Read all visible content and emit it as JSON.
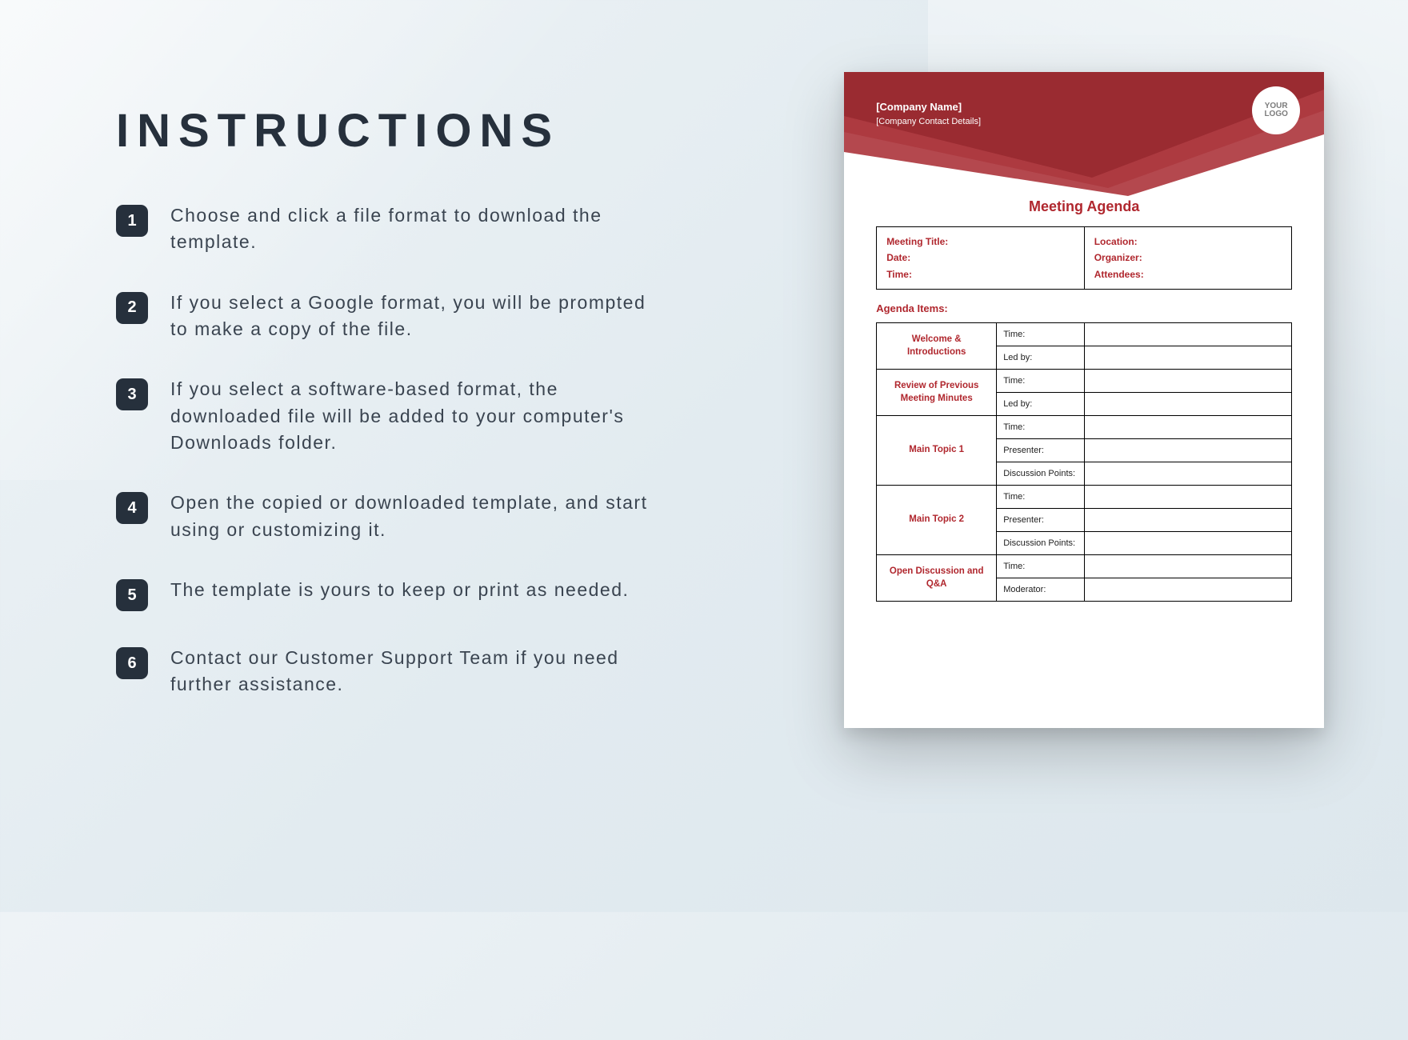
{
  "title": "INSTRUCTIONS",
  "steps": [
    "Choose and click a file format to download the template.",
    "If you select a Google format, you will be prompted to make a copy of the file.",
    "If you select a software-based format, the downloaded file will be added to your computer's Downloads folder.",
    "Open the copied or downloaded template, and start using or customizing it.",
    "The template is yours to keep or print as needed.",
    "Contact our Customer Support Team if you need further assistance."
  ],
  "doc": {
    "company_name": "[Company Name]",
    "company_contact": "[Company Contact Details]",
    "logo_top": "YOUR",
    "logo_bottom": "LOGO",
    "title": "Meeting Agenda",
    "meta_left": {
      "meeting_title": "Meeting Title:",
      "date": "Date:",
      "time": "Time:"
    },
    "meta_right": {
      "location": "Location:",
      "organizer": "Organizer:",
      "attendees": "Attendees:"
    },
    "agenda_label": "Agenda Items:",
    "items": [
      {
        "topic": "Welcome & Introductions",
        "rows": [
          "Time:",
          "Led by:"
        ]
      },
      {
        "topic": "Review of Previous Meeting Minutes",
        "rows": [
          "Time:",
          "Led by:"
        ]
      },
      {
        "topic": "Main Topic 1",
        "rows": [
          "Time:",
          "Presenter:",
          "Discussion Points:"
        ]
      },
      {
        "topic": "Main Topic 2",
        "rows": [
          "Time:",
          "Presenter:",
          "Discussion Points:"
        ]
      },
      {
        "topic": "Open Discussion and Q&A",
        "rows": [
          "Time:",
          "Moderator:"
        ]
      }
    ]
  }
}
